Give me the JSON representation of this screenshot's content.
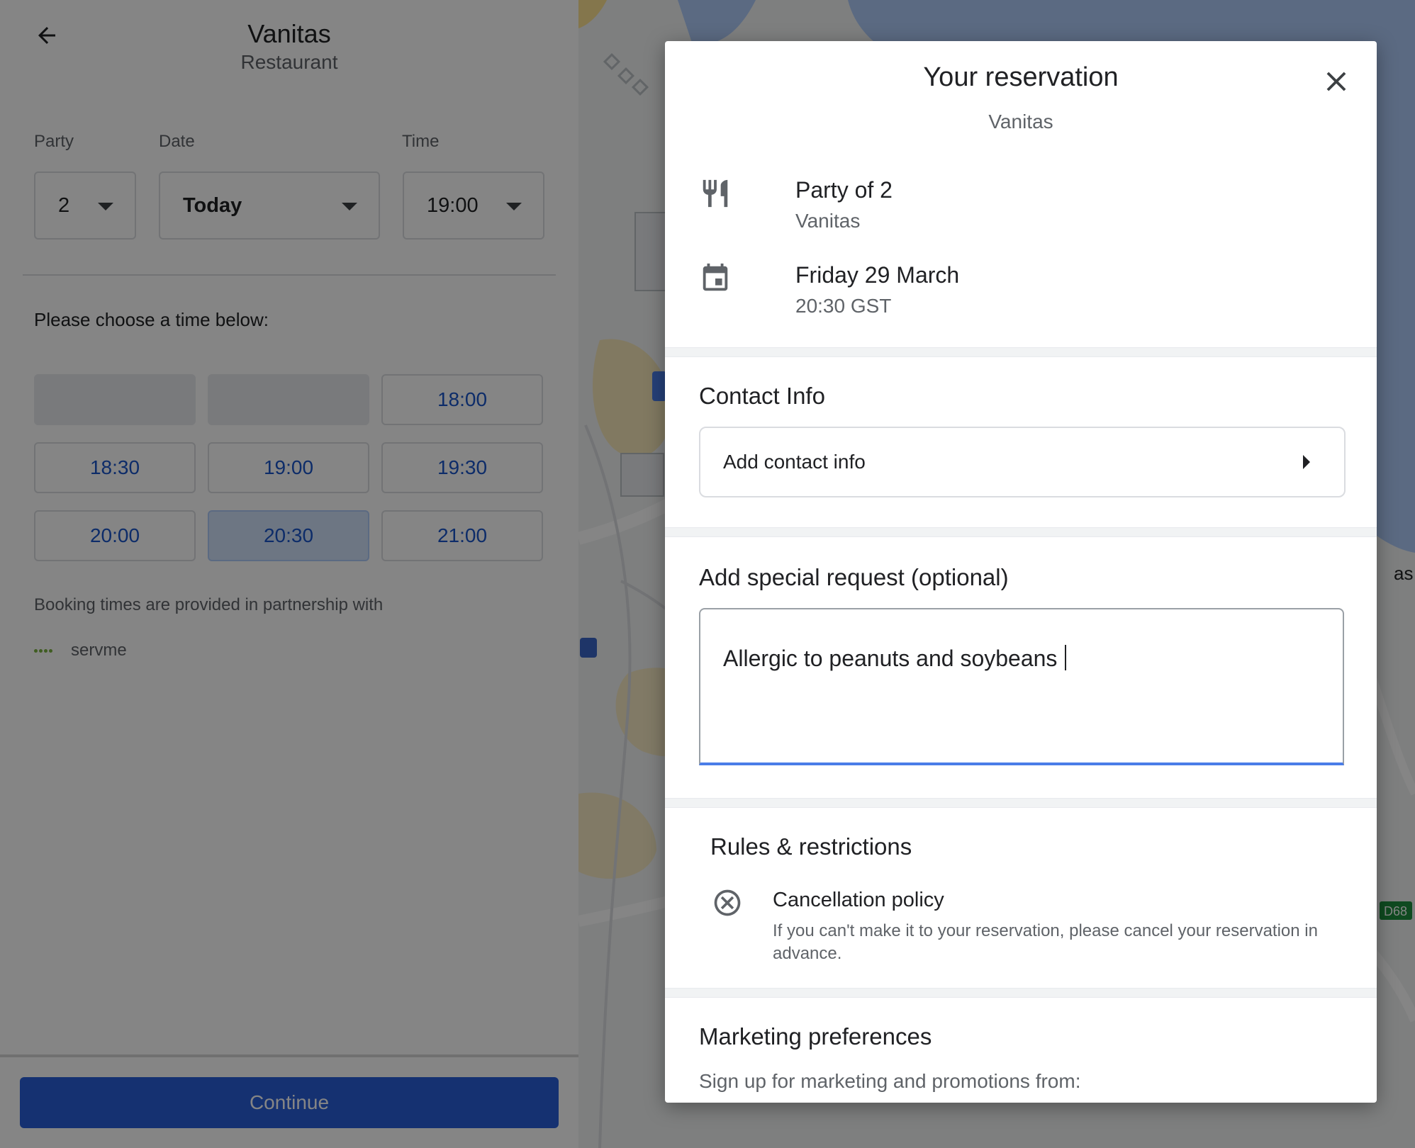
{
  "left_panel": {
    "title": "Vanitas",
    "subtitle": "Restaurant",
    "labels": {
      "party": "Party",
      "date": "Date",
      "time": "Time"
    },
    "party_value": "2",
    "date_value": "Today",
    "time_value": "19:00",
    "choose_text": "Please choose a time below:",
    "time_slots": [
      "",
      "",
      "18:00",
      "18:30",
      "19:00",
      "19:30",
      "20:00",
      "20:30",
      "21:00"
    ],
    "selected_slot": "20:30",
    "partner_text": "Booking times are provided in partnership with",
    "partner_name": "servme",
    "continue_label": "Continue"
  },
  "map": {
    "labels": {
      "edge_text": "as",
      "road_badge": "D68"
    },
    "colors": {
      "water": "#aecbfa",
      "land": "#f1f3f4",
      "park": "#fde293",
      "road": "#ffffff",
      "road_badge": "#1e8e3e"
    }
  },
  "modal": {
    "title": "Your reservation",
    "subtitle": "Vanitas",
    "party_heading": "Party of 2",
    "party_detail": "Vanitas",
    "date_heading": "Friday 29 March",
    "date_detail": "20:30 GST",
    "contact_title": "Contact Info",
    "contact_button": "Add contact info",
    "special_title": "Add special request (optional)",
    "special_value": "Allergic to peanuts and soybeans ",
    "rules_title": "Rules & restrictions",
    "rule_heading": "Cancellation policy",
    "rule_detail": "If you can't make it to your reservation, please cancel your reservation in advance.",
    "marketing_title": "Marketing preferences",
    "marketing_detail": "Sign up for marketing and promotions from:"
  },
  "colors": {
    "accent": "#1a73e8",
    "continue_bg": "#2a5fd8",
    "slot_text": "#1a55c9",
    "selected_slot_bg": "#d2e3fc"
  }
}
